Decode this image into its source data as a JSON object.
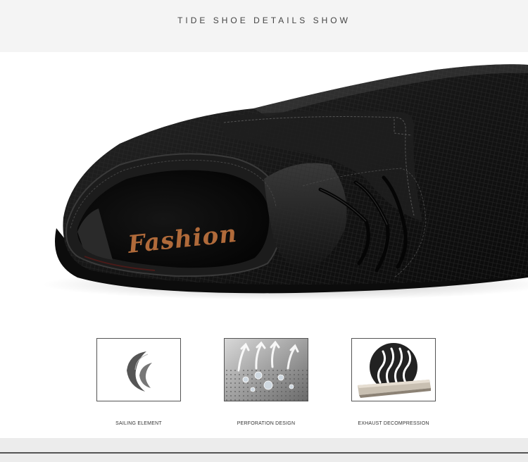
{
  "header": {
    "title": "TIDE SHOE  DETAILS SHOW"
  },
  "hero": {
    "insole_text": "Fashion"
  },
  "features": [
    {
      "icon": "sailing-element-icon",
      "caption": "SAILING ELEMENT"
    },
    {
      "icon": "perforation-design-icon",
      "caption": "PERFORATION DESIGN"
    },
    {
      "icon": "exhaust-decompression-icon",
      "caption": "EXHAUST DECOMPRESSION"
    }
  ],
  "colors": {
    "shoe": "#151515",
    "insole_text": "#b06a3a",
    "header_bg": "#f4f4f4"
  }
}
